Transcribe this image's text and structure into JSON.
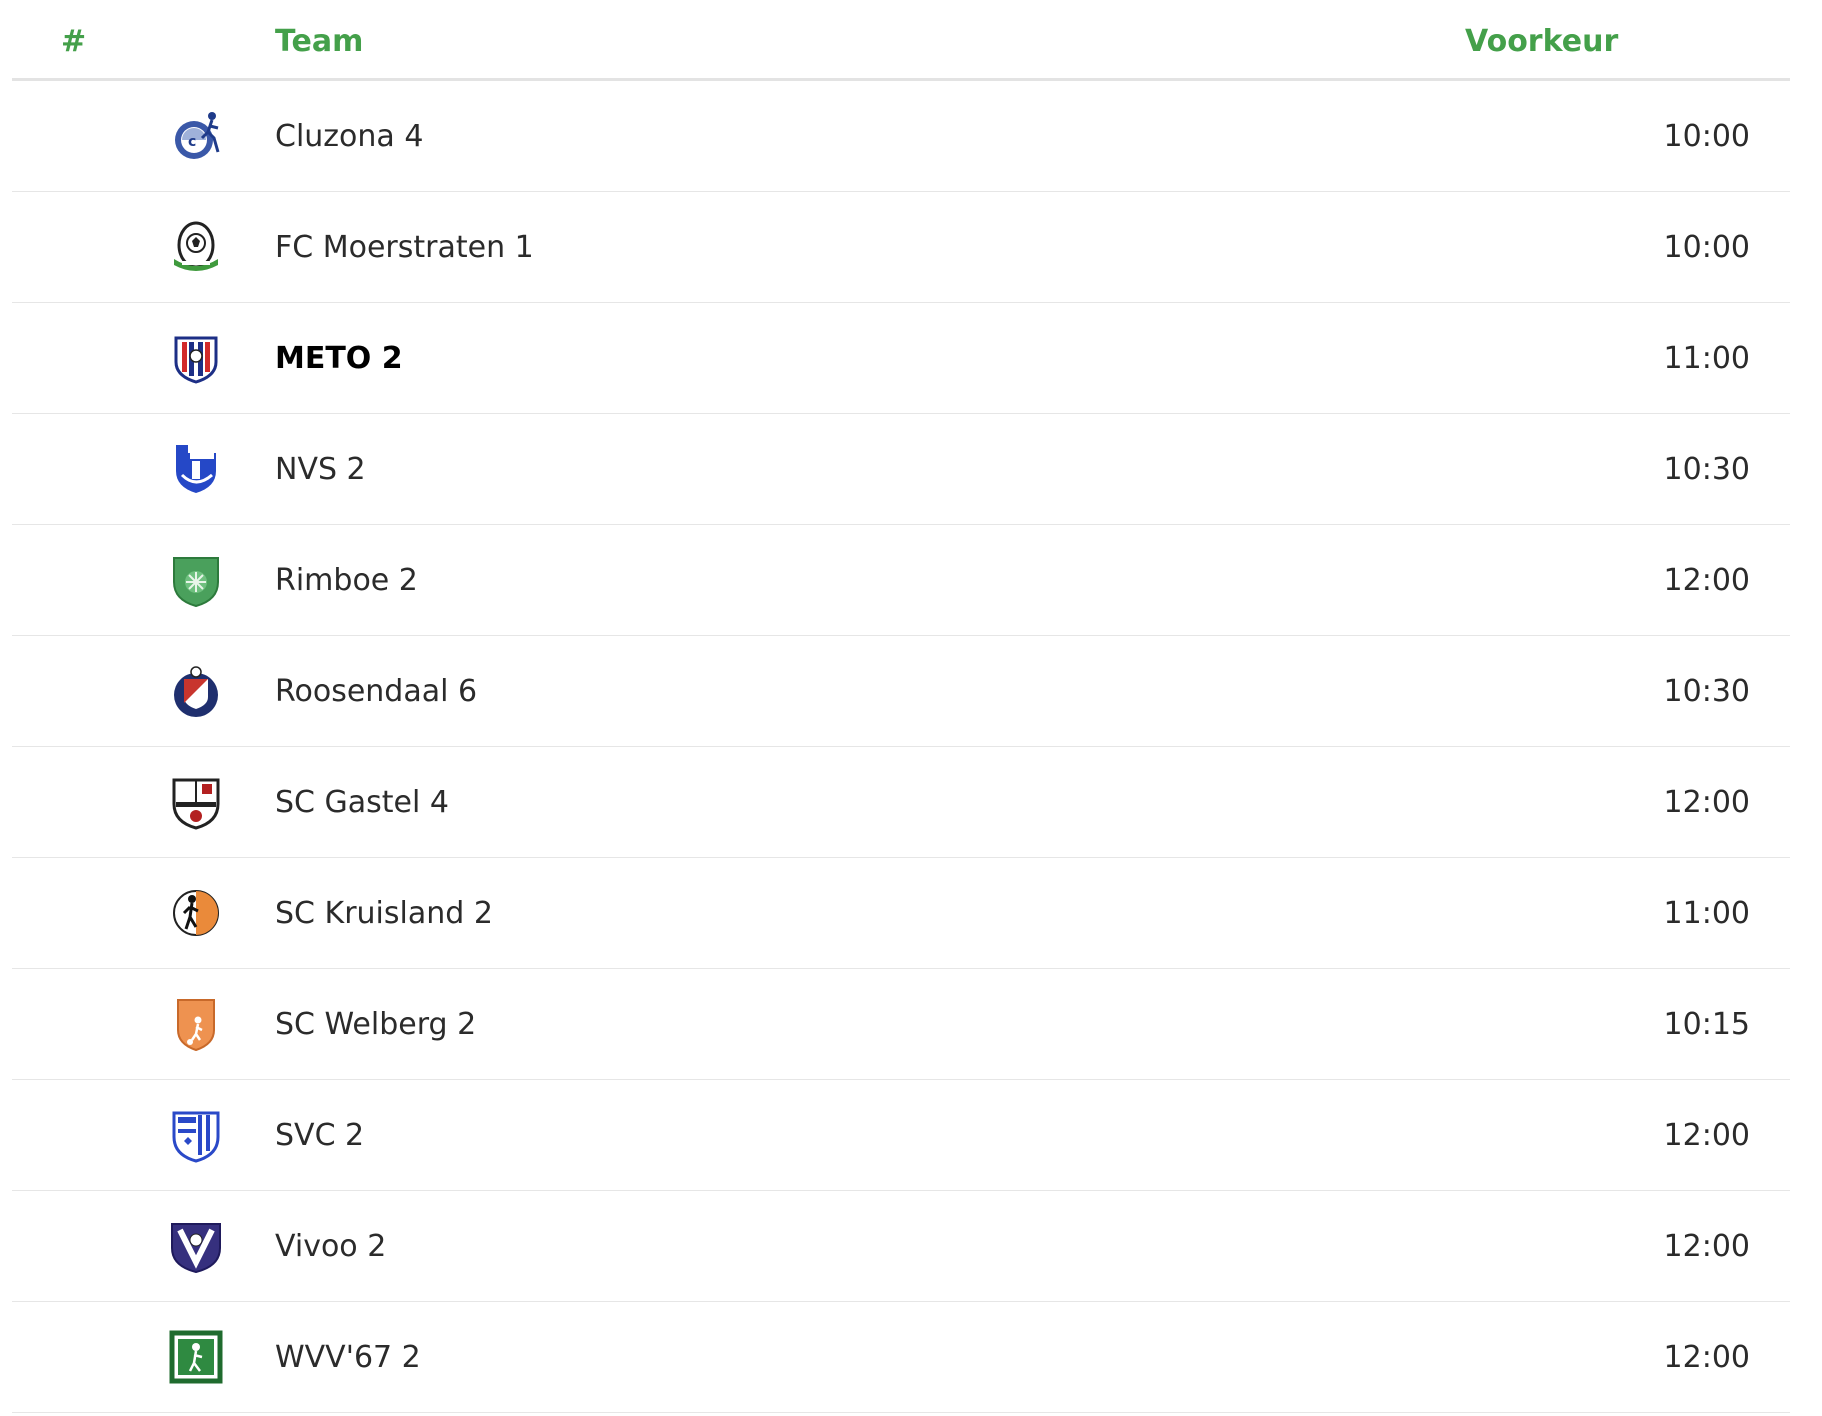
{
  "header": {
    "num_label": "#",
    "team_label": "Team",
    "pref_label": "Voorkeur"
  },
  "colors": {
    "accent": "#44a04a"
  },
  "rows": [
    {
      "team": "Cluzona 4",
      "time": "10:00",
      "logo": "cluzona-logo-icon"
    },
    {
      "team": "FC Moerstraten 1",
      "time": "10:00",
      "logo": "fc-moerstraten-logo-icon"
    },
    {
      "team": "METO 2",
      "time": "11:00",
      "logo": "meto-logo-icon",
      "highlight": true
    },
    {
      "team": "NVS 2",
      "time": "10:30",
      "logo": "nvs-logo-icon"
    },
    {
      "team": "Rimboe 2",
      "time": "12:00",
      "logo": "rimboe-logo-icon"
    },
    {
      "team": "Roosendaal 6",
      "time": "10:30",
      "logo": "roosendaal-logo-icon"
    },
    {
      "team": "SC Gastel 4",
      "time": "12:00",
      "logo": "sc-gastel-logo-icon"
    },
    {
      "team": "SC Kruisland 2",
      "time": "11:00",
      "logo": "sc-kruisland-logo-icon"
    },
    {
      "team": "SC Welberg 2",
      "time": "10:15",
      "logo": "sc-welberg-logo-icon"
    },
    {
      "team": "SVC 2",
      "time": "12:00",
      "logo": "svc-logo-icon"
    },
    {
      "team": "Vivoo 2",
      "time": "12:00",
      "logo": "vivoo-logo-icon"
    },
    {
      "team": "WVV'67 2",
      "time": "12:00",
      "logo": "wvv67-logo-icon"
    }
  ]
}
